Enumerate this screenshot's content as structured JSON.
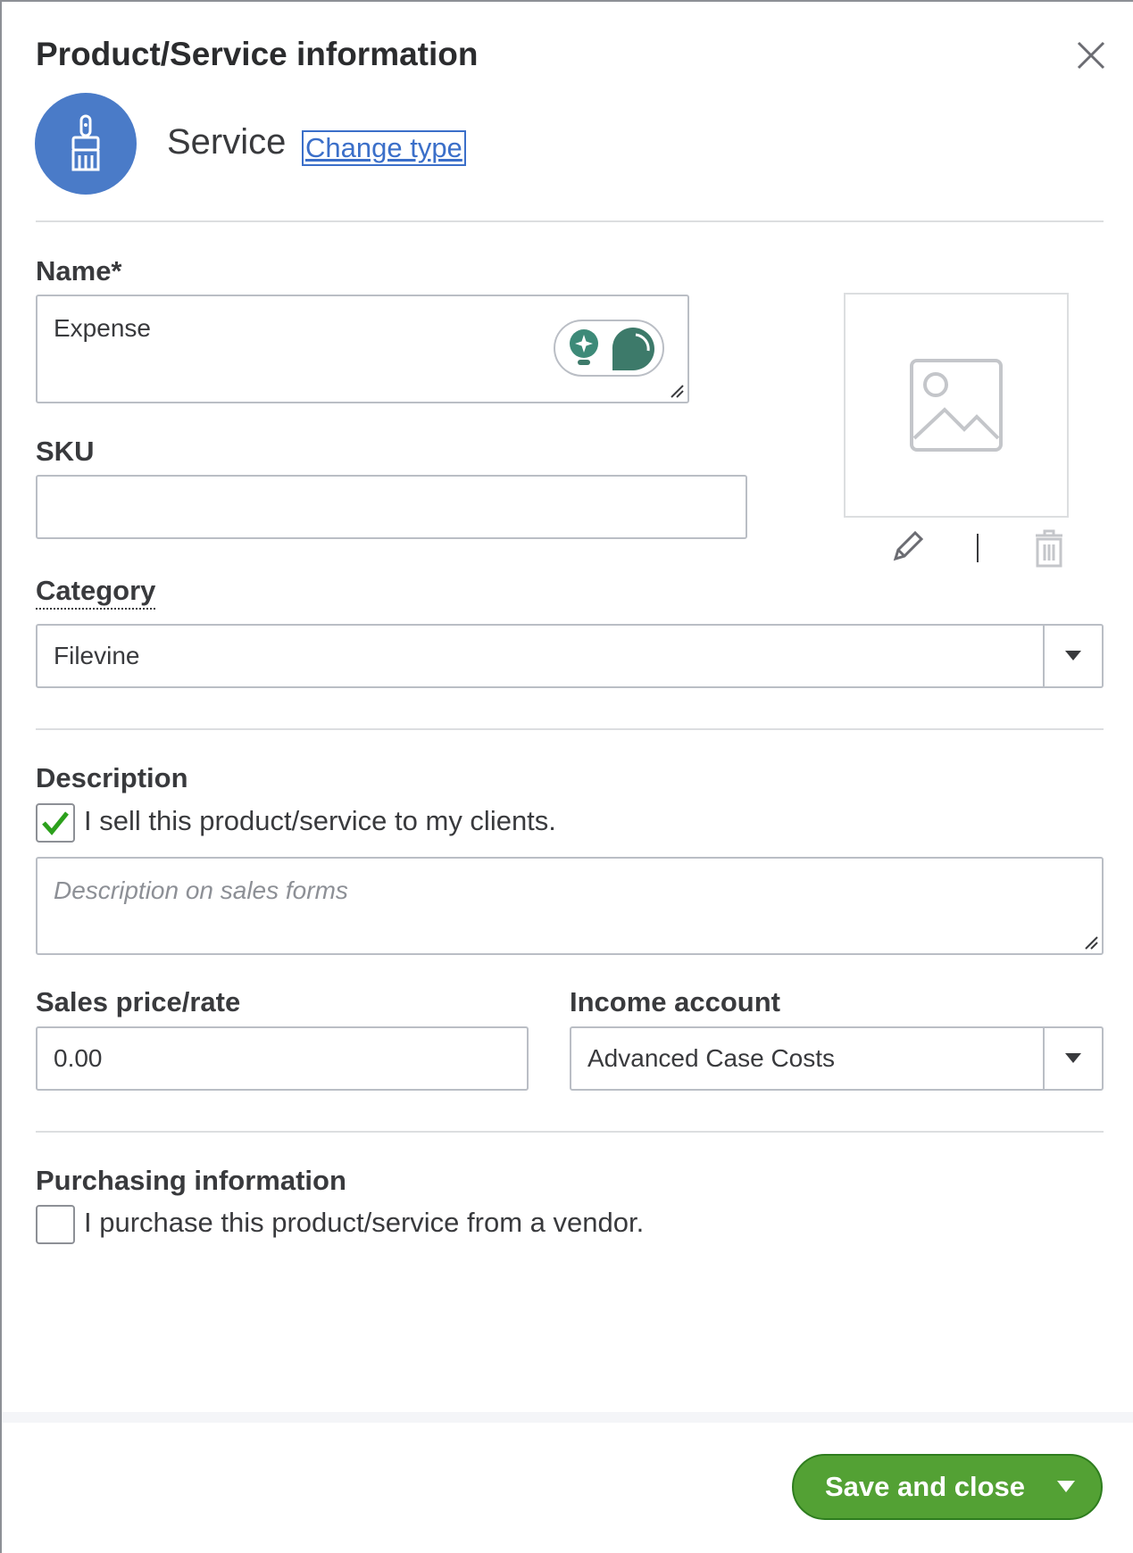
{
  "header": {
    "title": "Product/Service information"
  },
  "type": {
    "name": "Service",
    "change_label": "Change type"
  },
  "name_field": {
    "label": "Name*",
    "value": "Expense"
  },
  "sku_field": {
    "label": "SKU",
    "value": ""
  },
  "category_field": {
    "label": "Category",
    "value": "Filevine"
  },
  "description": {
    "label": "Description",
    "sell_checkbox_label": "I sell this product/service to my clients.",
    "sell_checked": true,
    "placeholder": "Description on sales forms"
  },
  "sales_price": {
    "label": "Sales price/rate",
    "value": "0.00"
  },
  "income_account": {
    "label": "Income account",
    "value": "Advanced Case Costs"
  },
  "purchasing": {
    "label": "Purchasing information",
    "purchase_checkbox_label": "I purchase this product/service from a vendor.",
    "purchase_checked": false
  },
  "footer": {
    "save_label": "Save and close"
  },
  "colors": {
    "primary_green": "#53a134",
    "link_blue": "#3b6fc9",
    "type_circle": "#4a7bc8",
    "ai_green": "#3d7a6a"
  },
  "icons": [
    "close-icon",
    "paintbrush-icon",
    "lightbulb-icon",
    "chat-bubble-icon",
    "image-placeholder-icon",
    "pencil-icon",
    "trash-icon",
    "chevron-down-icon",
    "checkmark-icon"
  ]
}
